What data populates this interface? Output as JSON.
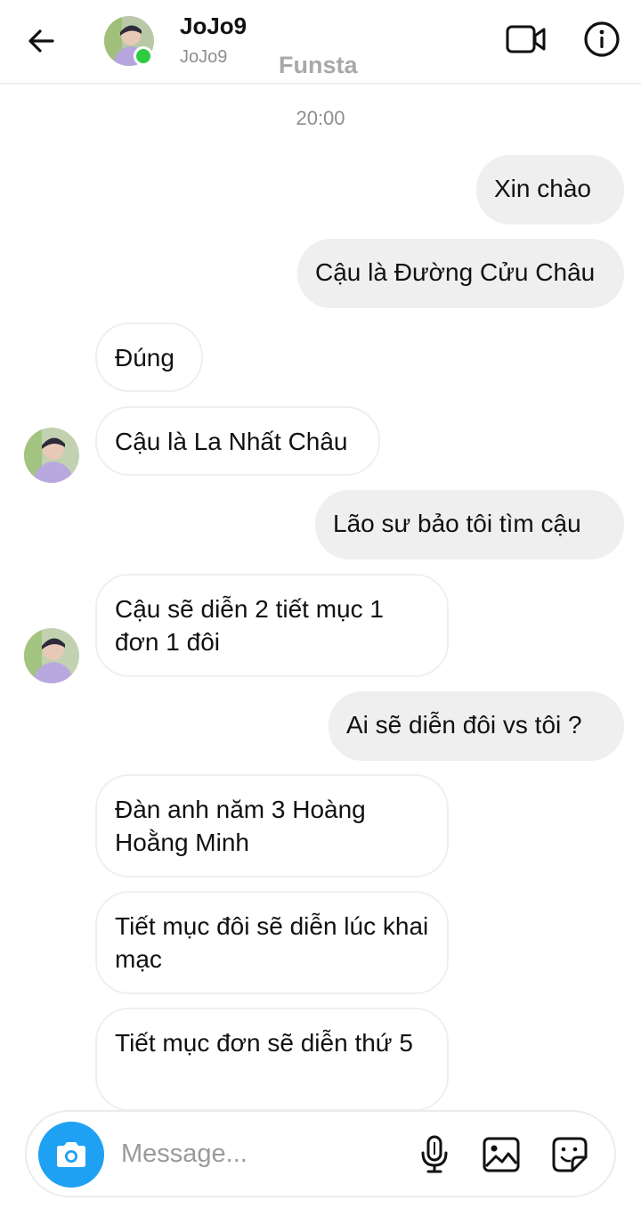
{
  "header": {
    "name": "JoJo9",
    "username": "JoJo9",
    "watermark": "Funsta"
  },
  "icons": {
    "back": "back-arrow-icon",
    "video": "video-call-icon",
    "info": "info-icon",
    "camera": "camera-icon",
    "mic": "microphone-icon",
    "gallery": "gallery-icon",
    "sticker": "sticker-icon"
  },
  "colors": {
    "online": "#2ecc40",
    "camera_button": "#1ea1f2",
    "outgoing_bubble": "#efefef",
    "muted_text": "#8e8e8e"
  },
  "timestamp": "20:00",
  "messages": [
    {
      "dir": "out",
      "text": "Xin chào"
    },
    {
      "dir": "out",
      "text": "Cậu là Đường Cửu Châu"
    },
    {
      "dir": "in",
      "text": "Đúng"
    },
    {
      "dir": "in",
      "text": "Cậu là La Nhất Châu"
    },
    {
      "dir": "out",
      "text": "Lão sư bảo tôi tìm cậu"
    },
    {
      "dir": "in",
      "text": "Cậu sẽ diễn 2 tiết mục 1 đơn 1 đôi"
    },
    {
      "dir": "out",
      "text": "Ai sẽ diễn đôi vs tôi ?"
    },
    {
      "dir": "in",
      "text": "Đàn anh năm 3 Hoàng Hoằng Minh"
    },
    {
      "dir": "in",
      "text": "Tiết mục đôi sẽ diễn lúc khai mạc"
    },
    {
      "dir": "in",
      "text": "Tiết mục đơn sẽ diễn thứ 5"
    }
  ],
  "composer": {
    "placeholder": "Message..."
  }
}
